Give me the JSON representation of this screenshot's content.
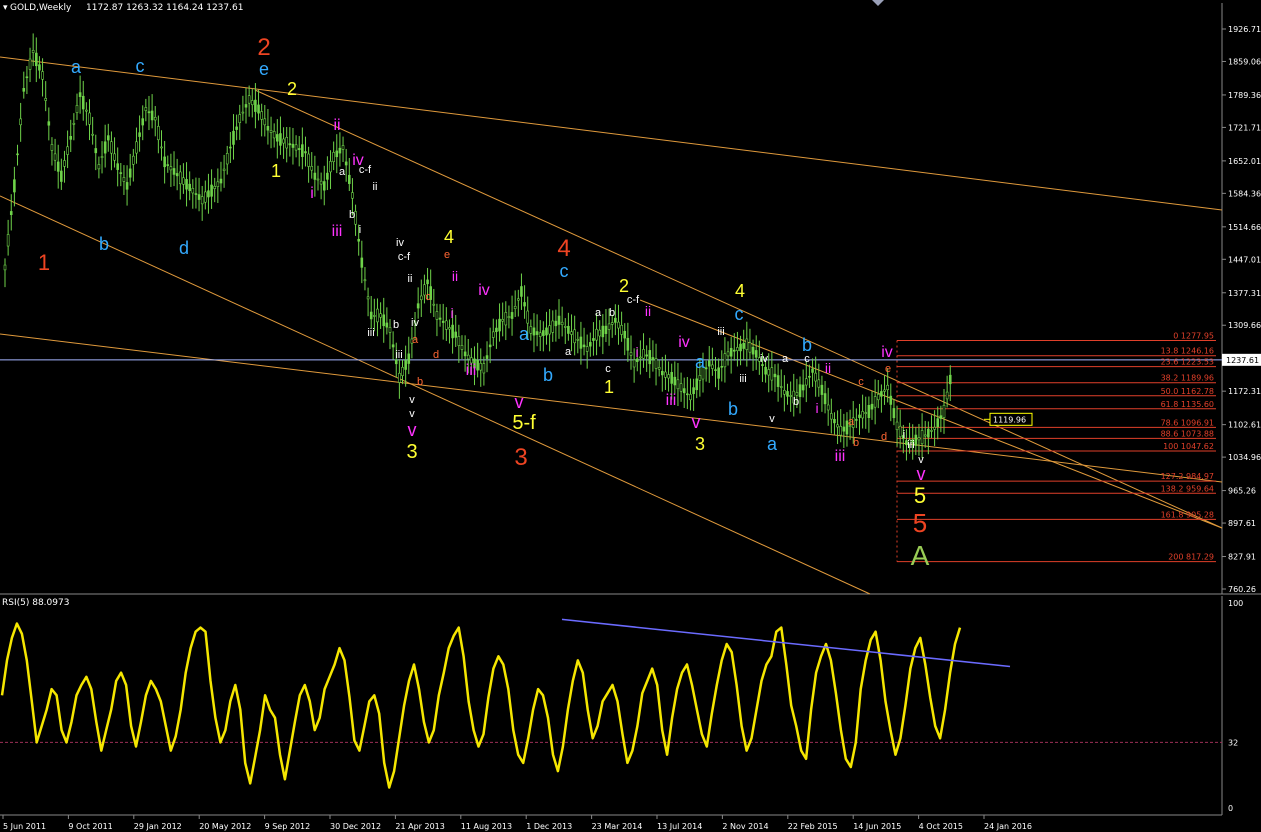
{
  "header": {
    "symbol": "GOLD,Weekly",
    "ohlc": "1172.87 1263.32 1164.24 1237.61"
  },
  "colors": {
    "background": "#000000",
    "candle": "#6fd34a",
    "channel": "#e09a3c",
    "fib": "#e0402a",
    "price_line": "#a7b7ff",
    "rsi": "#f5e600",
    "rsi_trend": "#6b6bff",
    "rsi_level": "#9a2f56",
    "red_label": "#ee4422",
    "yellow_label": "#ffff33",
    "cyan_label": "#33aaff",
    "magenta_label": "#ff33ff",
    "white_label": "#ffffff",
    "green_label": "#99cc55",
    "orange_label": "#ff6633"
  },
  "chart_data": [
    {
      "type": "candlestick",
      "title": "GOLD,Weekly",
      "ylim": [
        732,
        1955
      ],
      "y_ticks": [
        "1926.71",
        "1859.06",
        "1789.36",
        "1721.71",
        "1652.01",
        "1584.36",
        "1514.66",
        "1447.01",
        "1377.31",
        "1309.66",
        "1240.10",
        "1172.31",
        "1102.61",
        "1034.96",
        "965.26",
        "897.61",
        "827.91",
        "760.26"
      ],
      "x_labels": [
        "5 Jun 2011",
        "9 Oct 2011",
        "29 Jan 2012",
        "20 May 2012",
        "9 Sep 2012",
        "30 Dec 2012",
        "21 Apr 2013",
        "11 Aug 2013",
        "1 Dec 2013",
        "23 Mar 2014",
        "13 Jul 2014",
        "2 Nov 2014",
        "22 Feb 2015",
        "14 Jun 2015",
        "4 Oct 2015",
        "24 Jan 2016"
      ],
      "current_price": "1237.61",
      "price_label": "1119.96",
      "close_path": [
        [
          0,
          1430
        ],
        [
          3,
          1600
        ],
        [
          6,
          1800
        ],
        [
          9,
          1880
        ],
        [
          12,
          1830
        ],
        [
          15,
          1680
        ],
        [
          18,
          1620
        ],
        [
          21,
          1700
        ],
        [
          24,
          1790
        ],
        [
          27,
          1740
        ],
        [
          30,
          1640
        ],
        [
          33,
          1700
        ],
        [
          36,
          1640
        ],
        [
          39,
          1600
        ],
        [
          42,
          1680
        ],
        [
          45,
          1760
        ],
        [
          48,
          1740
        ],
        [
          51,
          1650
        ],
        [
          54,
          1630
        ],
        [
          57,
          1610
        ],
        [
          60,
          1590
        ],
        [
          63,
          1570
        ],
        [
          66,
          1590
        ],
        [
          69,
          1610
        ],
        [
          72,
          1680
        ],
        [
          75,
          1740
        ],
        [
          78,
          1780
        ],
        [
          81,
          1760
        ],
        [
          84,
          1720
        ],
        [
          87,
          1700
        ],
        [
          90,
          1690
        ],
        [
          93,
          1680
        ],
        [
          96,
          1670
        ],
        [
          99,
          1620
        ],
        [
          102,
          1600
        ],
        [
          105,
          1660
        ],
        [
          108,
          1680
        ],
        [
          111,
          1580
        ],
        [
          114,
          1440
        ],
        [
          117,
          1330
        ],
        [
          120,
          1330
        ],
        [
          123,
          1300
        ],
        [
          126,
          1200
        ],
        [
          129,
          1240
        ],
        [
          132,
          1350
        ],
        [
          135,
          1400
        ],
        [
          138,
          1330
        ],
        [
          141,
          1310
        ],
        [
          144,
          1290
        ],
        [
          147,
          1250
        ],
        [
          150,
          1230
        ],
        [
          153,
          1220
        ],
        [
          156,
          1290
        ],
        [
          159,
          1320
        ],
        [
          162,
          1330
        ],
        [
          165,
          1380
        ],
        [
          168,
          1300
        ],
        [
          171,
          1290
        ],
        [
          174,
          1300
        ],
        [
          177,
          1320
        ],
        [
          180,
          1300
        ],
        [
          183,
          1280
        ],
        [
          186,
          1260
        ],
        [
          189,
          1290
        ],
        [
          192,
          1300
        ],
        [
          195,
          1320
        ],
        [
          198,
          1290
        ],
        [
          201,
          1230
        ],
        [
          204,
          1250
        ],
        [
          207,
          1240
        ],
        [
          210,
          1210
        ],
        [
          213,
          1200
        ],
        [
          216,
          1180
        ],
        [
          219,
          1160
        ],
        [
          222,
          1200
        ],
        [
          225,
          1230
        ],
        [
          228,
          1210
        ],
        [
          231,
          1250
        ],
        [
          234,
          1260
        ],
        [
          237,
          1270
        ],
        [
          240,
          1250
        ],
        [
          243,
          1215
        ],
        [
          246,
          1205
        ],
        [
          249,
          1170
        ],
        [
          252,
          1160
        ],
        [
          255,
          1180
        ],
        [
          258,
          1215
        ],
        [
          261,
          1175
        ],
        [
          264,
          1120
        ],
        [
          267,
          1090
        ],
        [
          270,
          1100
        ],
        [
          273,
          1120
        ],
        [
          276,
          1130
        ],
        [
          279,
          1160
        ],
        [
          282,
          1180
        ],
        [
          285,
          1100
        ],
        [
          288,
          1065
        ],
        [
          291,
          1070
        ],
        [
          294,
          1080
        ],
        [
          297,
          1095
        ],
        [
          300,
          1130
        ],
        [
          303,
          1230
        ]
      ],
      "fib_levels": [
        {
          "label": "0 1277.95",
          "price": 1277.95
        },
        {
          "label": "13.8 1246.16",
          "price": 1246.16
        },
        {
          "label": "23.6 1223.53",
          "price": 1223.53
        },
        {
          "label": "38.2 1189.96",
          "price": 1189.96
        },
        {
          "label": "50.0 1162.78",
          "price": 1162.78
        },
        {
          "label": "61.8 1135.60",
          "price": 1135.6
        },
        {
          "label": "78.6 1096.91",
          "price": 1096.91
        },
        {
          "label": "88.6 1073.88",
          "price": 1073.88
        },
        {
          "label": "100 1047.62",
          "price": 1047.62
        },
        {
          "label": "127.2 984.97",
          "price": 984.97
        },
        {
          "label": "138.2 959.64",
          "price": 959.64
        },
        {
          "label": "161.8 905.28",
          "price": 905.28
        },
        {
          "label": "200 817.29",
          "price": 817.29
        }
      ]
    },
    {
      "type": "line",
      "title": "RSI(5) 88.0973",
      "ylim": [
        0,
        100
      ],
      "y_ticks": [
        "100",
        "32",
        "0"
      ],
      "level": 32,
      "values": [
        55,
        72,
        83,
        90,
        85,
        72,
        52,
        32,
        40,
        48,
        58,
        55,
        38,
        32,
        42,
        55,
        60,
        64,
        58,
        42,
        28,
        38,
        48,
        62,
        66,
        60,
        40,
        30,
        42,
        55,
        62,
        58,
        52,
        40,
        28,
        35,
        48,
        66,
        78,
        86,
        88,
        86,
        62,
        44,
        32,
        38,
        52,
        60,
        48,
        22,
        12,
        25,
        38,
        55,
        48,
        44,
        26,
        14,
        28,
        42,
        55,
        60,
        52,
        38,
        44,
        58,
        64,
        70,
        78,
        72,
        54,
        33,
        28,
        40,
        52,
        55,
        46,
        22,
        10,
        18,
        34,
        50,
        62,
        70,
        58,
        42,
        32,
        38,
        55,
        66,
        78,
        84,
        88,
        74,
        52,
        38,
        30,
        36,
        54,
        68,
        74,
        70,
        58,
        38,
        26,
        22,
        34,
        48,
        58,
        55,
        44,
        26,
        18,
        30,
        48,
        62,
        72,
        66,
        48,
        34,
        40,
        52,
        56,
        60,
        52,
        36,
        22,
        28,
        40,
        56,
        62,
        68,
        60,
        38,
        26,
        44,
        58,
        66,
        70,
        60,
        48,
        36,
        30,
        46,
        60,
        72,
        80,
        76,
        60,
        40,
        28,
        34,
        48,
        62,
        70,
        74,
        86,
        88,
        70,
        50,
        40,
        28,
        24,
        48,
        66,
        74,
        80,
        72,
        56,
        38,
        24,
        20,
        32,
        58,
        72,
        82,
        86,
        72,
        52,
        38,
        26,
        34,
        50,
        68,
        78,
        83,
        70,
        54,
        40,
        34,
        48,
        66,
        80,
        88
      ]
    }
  ],
  "annotations": {
    "red": [
      "1",
      "2",
      "3",
      "4",
      "5"
    ],
    "yellow": [
      "1",
      "2",
      "3",
      "4",
      "5",
      "5-f",
      "1",
      "2",
      "3",
      "4",
      "1",
      "3",
      "5"
    ],
    "cyan": [
      "a",
      "b",
      "c",
      "d",
      "e",
      "a",
      "b",
      "c",
      "a",
      "b",
      "c",
      "a",
      "b"
    ],
    "magenta": [
      "i",
      "ii",
      "iii",
      "iv",
      "v",
      "i",
      "ii",
      "iii",
      "iv",
      "v",
      "i",
      "ii",
      "iii",
      "iv",
      "v",
      "i",
      "ii",
      "iii",
      "iv",
      "v"
    ],
    "green_big": "A"
  }
}
